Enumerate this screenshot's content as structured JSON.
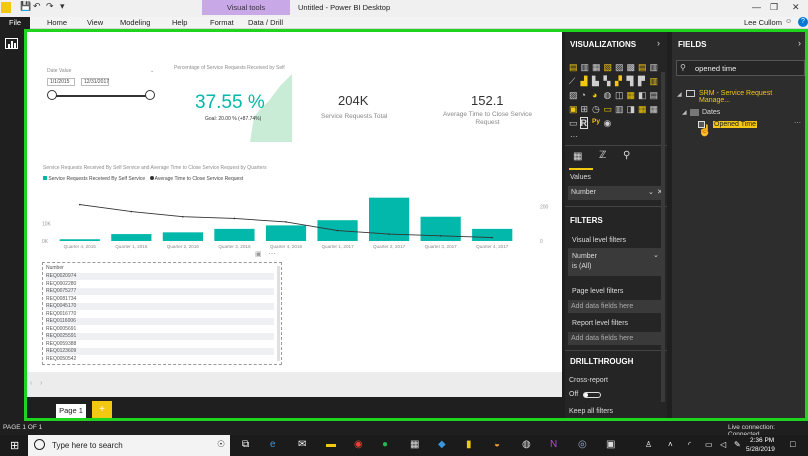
{
  "window": {
    "visual_tools_label": "Visual tools",
    "title": "Untitled - Power BI Desktop",
    "user": "Lee Cullom"
  },
  "ribbon": {
    "tabs": [
      "File",
      "Home",
      "View",
      "Modeling",
      "Help",
      "Format",
      "Data / Drill"
    ]
  },
  "canvas": {
    "slicer": {
      "label": "Date Value",
      "from": "1/1/2015",
      "to": "12/31/2017"
    },
    "gauge": {
      "title": "Percentage of Service Requests Received by Self",
      "value": "37.55 %",
      "goal": "Goal: 20.00 % (+87.74%)"
    },
    "card1": {
      "value": "204K",
      "label": "Service Requests Total"
    },
    "card2": {
      "value": "152.1",
      "label": "Average Time to Close Service Request"
    },
    "combo": {
      "title": "Service Requests Received By Self Service and Average Time to Close Service Request by Quarters",
      "legend_bar": "Service Requests Received By Self Service",
      "legend_line": "Average Time to Close Service Request"
    },
    "table": {
      "header": "Number",
      "rows": [
        "REQ0020974",
        "REQ0002280",
        "REQ0075277",
        "REQ0081734",
        "REQ0045170",
        "REQ0016770",
        "REQ0116006",
        "REQ0005691",
        "REQ0025591",
        "REQ0059388",
        "REQ0123609",
        "REQ0050542"
      ]
    },
    "page_tab": "Page 1"
  },
  "chart_data": {
    "type": "bar",
    "categories": [
      "Quarter 4, 2015",
      "Quarter 1, 2016",
      "Quarter 2, 2016",
      "Quarter 3, 2016",
      "Quarter 4, 2016",
      "Quarter 1, 2017",
      "Quarter 2, 2017",
      "Quarter 3, 2017",
      "Quarter 4, 2017"
    ],
    "series": [
      {
        "name": "Service Requests Received By Self Service",
        "values": [
          1,
          4,
          5,
          7,
          9,
          12,
          25,
          14,
          7
        ]
      },
      {
        "name": "Average Time to Close Service Request",
        "values": [
          210,
          170,
          140,
          130,
          110,
          60,
          40,
          30,
          20
        ]
      }
    ],
    "ylim_left": [
      0,
      30
    ],
    "ylim_right": [
      0,
      300
    ],
    "left_ticks": [
      "0K",
      "10K"
    ],
    "right_ticks": [
      "0",
      "200"
    ]
  },
  "visualizations_panel": {
    "title": "VISUALIZATIONS",
    "values_label": "Values",
    "values_field": "Number",
    "filters_title": "FILTERS",
    "visual_level": "Visual level filters",
    "filter_field": "Number",
    "filter_state": "is (All)",
    "page_level": "Page level filters",
    "add_data_1": "Add data fields here",
    "report_level": "Report level filters",
    "add_data_2": "Add data fields here",
    "drillthrough_title": "DRILLTHROUGH",
    "cross_report": "Cross-report",
    "off_label": "Off",
    "keep_all": "Keep all filters"
  },
  "fields_panel": {
    "title": "FIELDS",
    "search_value": "opened time",
    "table_name": "SRM - Service Request Manage...",
    "folder": "Dates",
    "field": "Opened Time"
  },
  "status": {
    "page": "PAGE 1 OF 1",
    "connection": "Live connection: Connected"
  },
  "taskbar": {
    "search_placeholder": "Type here to search",
    "time": "2:36 PM",
    "date": "5/28/2019"
  },
  "colors": {
    "accent_teal": "#01b8aa",
    "highlight_green": "#1fd41f",
    "page_tab_yellow": "#f2c811",
    "field_highlight": "#f2c811"
  }
}
